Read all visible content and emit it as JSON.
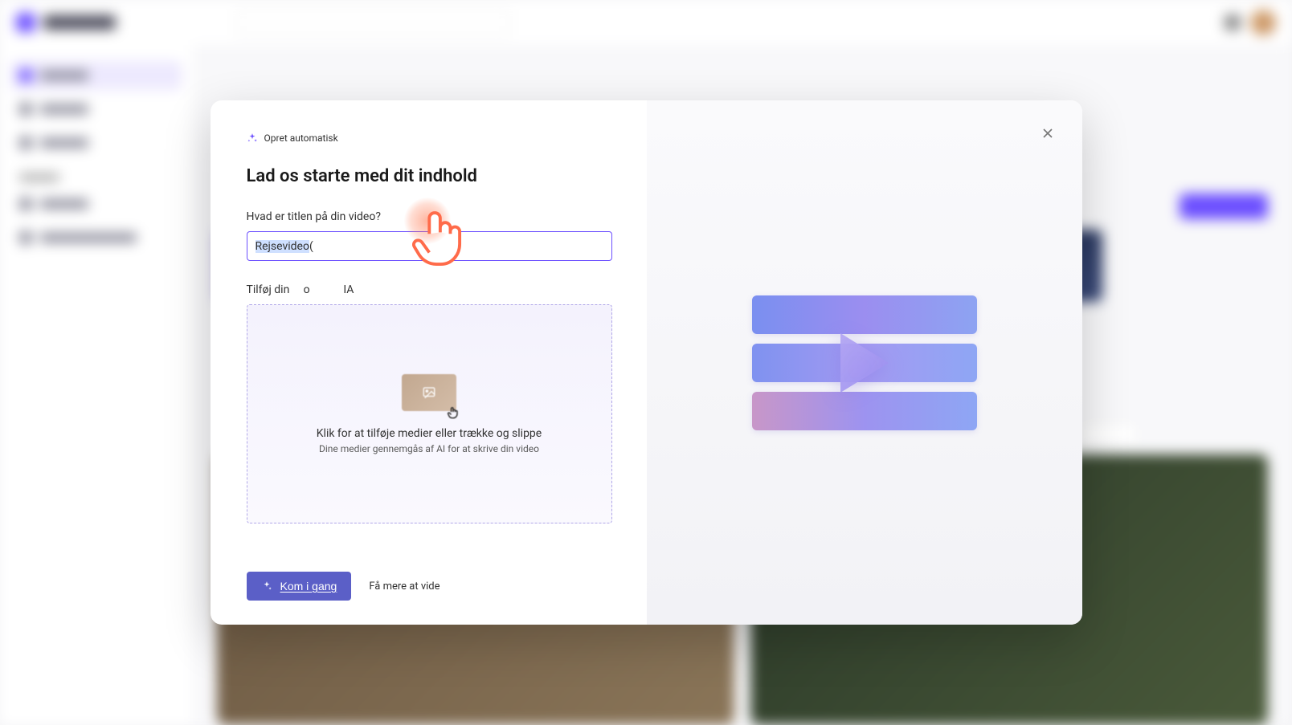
{
  "modal": {
    "badge_label": "Opret automatisk",
    "title": "Lad os starte med dit indhold",
    "title_field_label": "Hvad er titlen på din video?",
    "title_value_selected": "Rejsevideo",
    "title_value_rest": " (",
    "media_field_label_visible": "Tilføj din     o            IA",
    "dropzone_line1": "Klik for at tilføje medier eller trække og slippe",
    "dropzone_line2": "Dine medier gennemgås af AI for at skrive din video",
    "primary_button": "Kom i gang",
    "learn_more": "Få mere at vide"
  }
}
